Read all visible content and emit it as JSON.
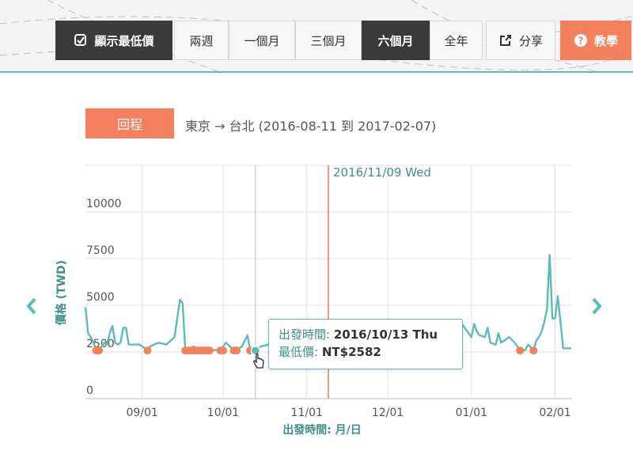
{
  "toolbar": {
    "show_lowest_label": "顯示最低價",
    "ranges": [
      "兩週",
      "一個月",
      "三個月",
      "六個月",
      "全年"
    ],
    "active_range": "六個月",
    "share_label": "分享",
    "tutorial_label": "教學"
  },
  "direction": {
    "label": "回程"
  },
  "route": {
    "text": "東京 → 台北 (2016-08-11 到 2017-02-07)"
  },
  "tooltip": {
    "date_label": "出發時間:",
    "date_value": "2016/10/13 Thu",
    "price_label": "最低價:",
    "price_value": "NT$2582"
  },
  "nav": {
    "prev_icon": "chevron-left-icon",
    "next_icon": "chevron-right-icon"
  },
  "colors": {
    "accent": "#f4805e",
    "teal": "#5cbdb6",
    "dark": "#3a3a3a"
  },
  "chart_data": {
    "type": "line",
    "ylabel": "價格 (TWD)",
    "xlabel": "出發時間: 月/日",
    "marker_label": "2016/11/09 Wed",
    "marker_date": "2016-11-09",
    "hover_date": "2016-10-13",
    "ylim": [
      0,
      12500
    ],
    "yticks": [
      0,
      2500,
      5000,
      7500,
      10000
    ],
    "xlim": [
      "2016-08-11",
      "2017-02-07"
    ],
    "xticks": [
      {
        "date": "2016-09-01",
        "label": "09/01"
      },
      {
        "date": "2016-10-01",
        "label": "10/01"
      },
      {
        "date": "2016-11-01",
        "label": "11/01"
      },
      {
        "date": "2016-12-01",
        "label": "12/01"
      },
      {
        "date": "2017-01-01",
        "label": "01/01"
      },
      {
        "date": "2017-02-01",
        "label": "02/01"
      }
    ],
    "series": [
      {
        "values": [
          [
            "2016-08-11",
            4900
          ],
          [
            "2016-08-12",
            3500
          ],
          [
            "2016-08-13",
            3300
          ],
          [
            "2016-08-14",
            3000
          ],
          [
            "2016-08-15",
            2600
          ],
          [
            "2016-08-16",
            2600
          ],
          [
            "2016-08-17",
            2800
          ],
          [
            "2016-08-18",
            3000
          ],
          [
            "2016-08-19",
            2900
          ],
          [
            "2016-08-20",
            3500
          ],
          [
            "2016-08-21",
            3900
          ],
          [
            "2016-08-22",
            3000
          ],
          [
            "2016-08-23",
            2900
          ],
          [
            "2016-08-24",
            3000
          ],
          [
            "2016-08-25",
            3800
          ],
          [
            "2016-08-26",
            3800
          ],
          [
            "2016-08-27",
            2900
          ],
          [
            "2016-08-31",
            2900
          ],
          [
            "2016-09-01",
            2800
          ],
          [
            "2016-09-03",
            2600
          ],
          [
            "2016-09-04",
            2800
          ],
          [
            "2016-09-07",
            3000
          ],
          [
            "2016-09-10",
            2900
          ],
          [
            "2016-09-13",
            3300
          ],
          [
            "2016-09-15",
            5300
          ],
          [
            "2016-09-16",
            5100
          ],
          [
            "2016-09-17",
            2600
          ],
          [
            "2016-09-18",
            2600
          ],
          [
            "2016-09-20",
            2800
          ],
          [
            "2016-09-22",
            2600
          ],
          [
            "2016-09-24",
            2600
          ],
          [
            "2016-09-26",
            2600
          ],
          [
            "2016-09-30",
            2600
          ],
          [
            "2016-10-02",
            3000
          ],
          [
            "2016-10-05",
            2600
          ],
          [
            "2016-10-06",
            2600
          ],
          [
            "2016-10-08",
            2800
          ],
          [
            "2016-10-10",
            3400
          ],
          [
            "2016-10-11",
            2600
          ],
          [
            "2016-10-13",
            2582
          ],
          [
            "2016-10-15",
            2800
          ],
          [
            "2016-10-18",
            2900
          ],
          [
            "2016-10-22",
            2900
          ]
        ]
      },
      {
        "values": [
          [
            "2016-12-28",
            4100
          ],
          [
            "2016-12-29",
            3900
          ],
          [
            "2016-12-30",
            3700
          ],
          [
            "2017-01-01",
            3300
          ],
          [
            "2017-01-02",
            4000
          ],
          [
            "2017-01-03",
            3600
          ],
          [
            "2017-01-04",
            3400
          ],
          [
            "2017-01-06",
            3300
          ],
          [
            "2017-01-07",
            3800
          ],
          [
            "2017-01-08",
            3000
          ],
          [
            "2017-01-10",
            2900
          ],
          [
            "2017-01-11",
            3500
          ],
          [
            "2017-01-12",
            3000
          ],
          [
            "2017-01-15",
            3300
          ],
          [
            "2017-01-17",
            3000
          ],
          [
            "2017-01-19",
            2600
          ],
          [
            "2017-01-21",
            2600
          ],
          [
            "2017-01-22",
            2900
          ],
          [
            "2017-01-24",
            2600
          ],
          [
            "2017-01-25",
            3100
          ],
          [
            "2017-01-26",
            3300
          ],
          [
            "2017-01-27",
            3600
          ],
          [
            "2017-01-28",
            4100
          ],
          [
            "2017-01-29",
            4800
          ],
          [
            "2017-01-30",
            7700
          ],
          [
            "2017-01-31",
            4300
          ],
          [
            "2017-02-01",
            4300
          ],
          [
            "2017-02-02",
            5500
          ],
          [
            "2017-02-04",
            2700
          ],
          [
            "2017-02-07",
            2700
          ]
        ]
      }
    ],
    "lowest_points": [
      "2016-08-15",
      "2016-08-16",
      "2016-09-03",
      "2016-09-17",
      "2016-09-18",
      "2016-09-19",
      "2016-09-20",
      "2016-09-21",
      "2016-09-22",
      "2016-09-23",
      "2016-09-24",
      "2016-09-25",
      "2016-09-26",
      "2016-09-30",
      "2016-10-01",
      "2016-10-05",
      "2016-10-06",
      "2016-10-11",
      "2016-10-13",
      "2017-01-19",
      "2017-01-24"
    ],
    "lowest_value": 2582,
    "grid": true,
    "legend": "none"
  }
}
